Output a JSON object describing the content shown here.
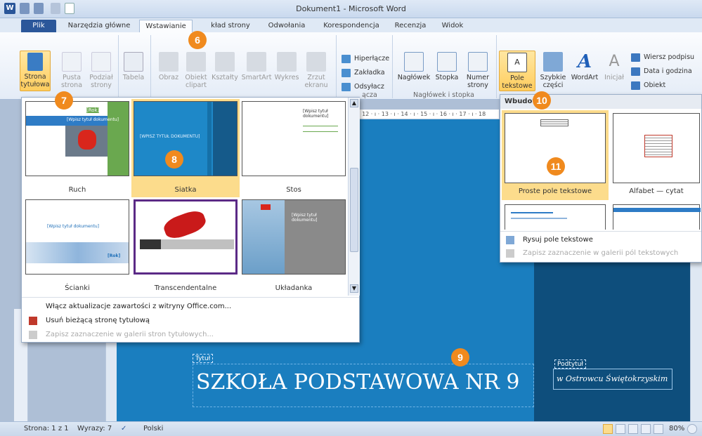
{
  "window": {
    "title": "Dokument1 - Microsoft Word"
  },
  "tabs": [
    "Plik",
    "Narzędzia główne",
    "Wstawianie",
    "Układ strony",
    "Odwołania",
    "Korespondencja",
    "Recenzja",
    "Widok"
  ],
  "tab_visible_labels": {
    "layout": "kład strony"
  },
  "ribbon": {
    "strona_tytulowa": "Strona tytułowa",
    "pusta_strona": "Pusta strona",
    "podzial_strony": "Podział strony",
    "tabela": "Tabela",
    "obraz": "Obraz",
    "obiekt_clipart": "Obiekt clipart",
    "ksztalty": "Kształty",
    "smartart": "SmartArt",
    "wykres": "Wykres",
    "zrzut_ekranu": "Zrzut ekranu",
    "hiperlacze": "Hiperłącze",
    "zakladka": "Zakładka",
    "odsylacz": "Odsyłacz",
    "naglowek": "Nagłówek",
    "stopka": "Stopka",
    "numer_strony": "Numer strony",
    "pole_tekstowe": "Pole tekstowe",
    "szybkie_czesci": "Szybkie części",
    "wordart": "WordArt",
    "inicjal": "Inicjał",
    "wiersz_podpisu": "Wiersz podpisu",
    "data_i_godzina": "Data i godzina",
    "obiekt": "Obiekt",
    "group_lacza": "ącza",
    "group_naglowek": "Nagłówek i stopka"
  },
  "ruler": "· 12 · ı · 13 · ı · 14 · ı · 15 · ı · 16 · ı · 17 · ı · 18",
  "gallery": {
    "items": [
      "Ruch",
      "Siatka",
      "Stos",
      "Ścianki",
      "Transcendentalne",
      "Układanka"
    ],
    "menu": [
      "Włącz aktualizacje zawartości z witryny Office.com...",
      "Usuń bieżącą stronę tytułową",
      "Zapisz zaznaczenie w galerii stron tytułowych..."
    ],
    "thumb_texts": {
      "ruch_rok": "[Rok]",
      "ruch_title": "[Wpisz tytuł dokumentu]",
      "siatka_title": "[WPISZ TYTUŁ DOKUMENTU]",
      "stos_title": "[Wpisz tytuł dokumentu]",
      "scianki_title": "[Wpisz tytuł dokumentu]",
      "scianki_rok": "[Rok]",
      "uklad_title": "[Wpisz tytuł dokumentu]"
    }
  },
  "textbox_panel": {
    "header": "Wbudow",
    "items": [
      "Proste pole tekstowe",
      "Alfabet — cytat"
    ],
    "menu": [
      "Rysuj pole tekstowe",
      "Zapisz zaznaczenie w galerii pól tekstowych"
    ]
  },
  "document": {
    "title_tag": "Tytuł",
    "heading": "SZKOŁA PODSTAWOWA NR 9",
    "subtitle_tag": "Podtytuł",
    "subtitle": "w Ostrowcu Świętokrzyskim"
  },
  "badges": [
    "6",
    "7",
    "8",
    "9",
    "10",
    "11"
  ],
  "status": {
    "page": "Strona: 1 z 1",
    "words": "Wyrazy: 7",
    "language": "Polski",
    "zoom": "80%"
  },
  "colors": {
    "accent": "#f08a1e",
    "file_tab": "#2b579a",
    "page_blue": "#1a7ebf",
    "selection": "#fcdc8c"
  }
}
